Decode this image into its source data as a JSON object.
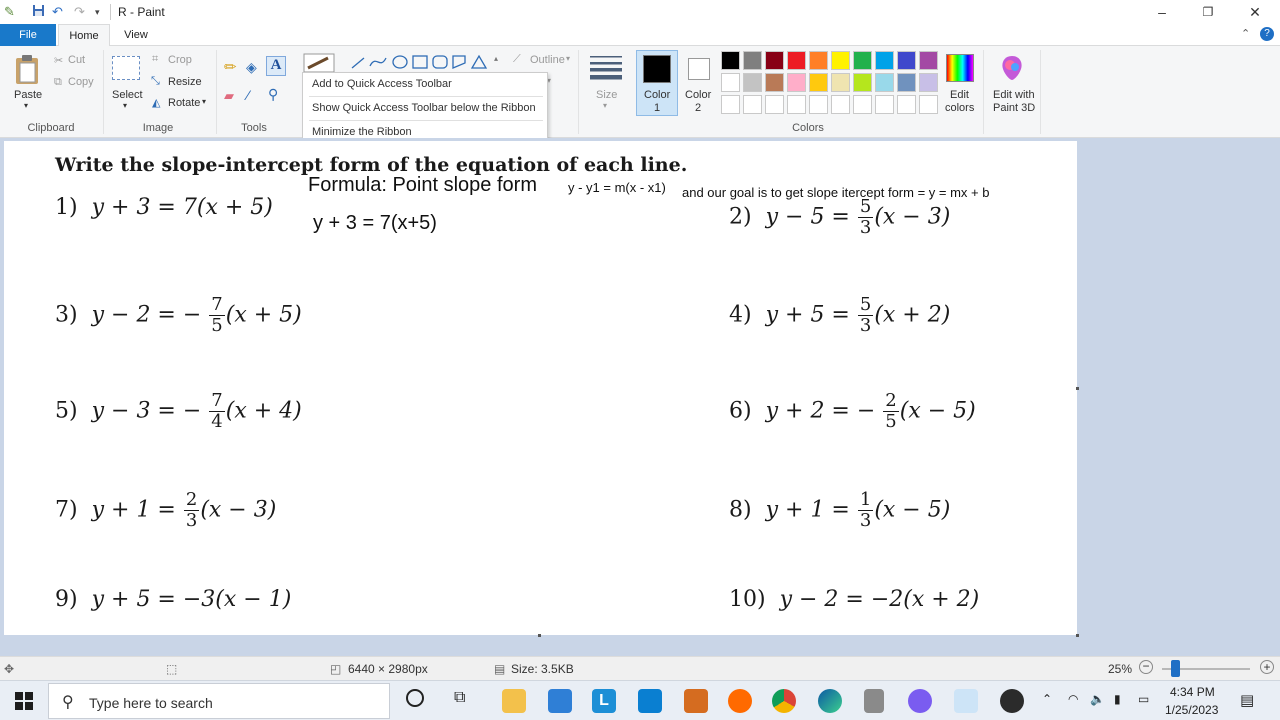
{
  "window": {
    "title": "R - Paint",
    "minimize": "–",
    "maximize": "❐",
    "close": "✕"
  },
  "tabs": {
    "file": "File",
    "home": "Home",
    "view": "View"
  },
  "ribbon": {
    "clipboard": {
      "paste": "Paste",
      "cut": "Cut",
      "copy": "Copy",
      "label": "Clipboard"
    },
    "image": {
      "select": "Select",
      "crop": "Crop",
      "resize": "Resize",
      "rotate": "Rotate",
      "label": "Image"
    },
    "tools": {
      "label": "Tools"
    },
    "shapes": {
      "outline": "Outline"
    },
    "size": {
      "label": "Size"
    },
    "color1": {
      "label": "Color",
      "num": "1",
      "value": "#000000"
    },
    "color2": {
      "label": "Color",
      "num": "2",
      "value": "#ffffff"
    },
    "edit_colors": {
      "line1": "Edit",
      "line2": "colors"
    },
    "paint3d": {
      "line1": "Edit with",
      "line2": "Paint 3D"
    },
    "colors_label": "Colors",
    "palette_row1": [
      "#000000",
      "#7f7f7f",
      "#880015",
      "#ed1c24",
      "#ff7f27",
      "#fff200",
      "#22b14c",
      "#00a2e8",
      "#3f48cc",
      "#a349a4"
    ],
    "palette_row2": [
      "#ffffff",
      "#c3c3c3",
      "#b97a57",
      "#ffaec9",
      "#ffc90e",
      "#efe4b0",
      "#b5e61d",
      "#99d9ea",
      "#7092be",
      "#c8bfe7"
    ]
  },
  "context_menu": {
    "items": [
      "Add to Quick Access Toolbar",
      "Show Quick Access Toolbar below the Ribbon",
      "Minimize the Ribbon"
    ]
  },
  "worksheet": {
    "heading": "Write the slope-intercept form of the equation of each line.",
    "formula_label": "Formula: Point slope form",
    "formula_eq": "y - y1 = m(x - x1)",
    "goal_text": "and our goal is to get slope itercept form = y = mx + b",
    "work_line": "y + 3 = 7(x+5)",
    "problems": {
      "p1": {
        "n": "1)",
        "lhs": "y + 3 = 7(x + 5)"
      },
      "p2": {
        "n": "2)",
        "lhs": "y − 5 =",
        "num": "5",
        "den": "3",
        "rhs": "(x − 3)"
      },
      "p3": {
        "n": "3)",
        "lhs": "y − 2 = −",
        "num": "7",
        "den": "5",
        "rhs": "(x + 5)"
      },
      "p4": {
        "n": "4)",
        "lhs": "y + 5 =",
        "num": "5",
        "den": "3",
        "rhs": "(x + 2)"
      },
      "p5": {
        "n": "5)",
        "lhs": "y − 3 = −",
        "num": "7",
        "den": "4",
        "rhs": "(x + 4)"
      },
      "p6": {
        "n": "6)",
        "lhs": "y + 2 = −",
        "num": "2",
        "den": "5",
        "rhs": "(x − 5)"
      },
      "p7": {
        "n": "7)",
        "lhs": "y + 1 =",
        "num": "2",
        "den": "3",
        "rhs": "(x − 3)"
      },
      "p8": {
        "n": "8)",
        "lhs": "y + 1 =",
        "num": "1",
        "den": "3",
        "rhs": "(x − 5)"
      },
      "p9": {
        "n": "9)",
        "lhs": "y + 5 = −3(x − 1)"
      },
      "p10": {
        "n": "10)",
        "lhs": "y − 2 = −2(x + 2)"
      }
    }
  },
  "status": {
    "dimensions": "6440 × 2980px",
    "size": "Size: 3.5KB",
    "zoom": "25%"
  },
  "taskbar": {
    "search_placeholder": "Type here to search",
    "time": "4:34 PM",
    "date": "1/25/2023"
  }
}
